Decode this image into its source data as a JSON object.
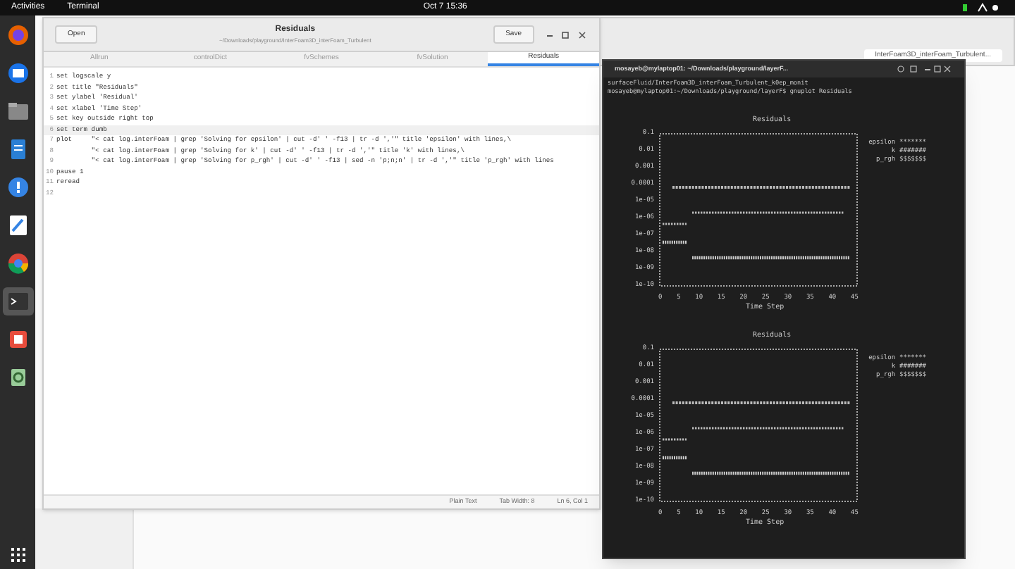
{
  "top_bar": {
    "activities": "Activities",
    "app_menu": "Terminal",
    "clock": "Oct 7  15:36"
  },
  "dock": [
    {
      "kind": "firefox",
      "selected": false
    },
    {
      "kind": "mail",
      "selected": false
    },
    {
      "kind": "files",
      "selected": false
    },
    {
      "kind": "writer",
      "selected": false
    },
    {
      "kind": "help",
      "selected": false
    },
    {
      "kind": "editor",
      "selected": false
    },
    {
      "kind": "chrome",
      "selected": false
    },
    {
      "kind": "terminal",
      "selected": true
    },
    {
      "kind": "software",
      "selected": false
    },
    {
      "kind": "recycle",
      "selected": false
    }
  ],
  "back_window": {
    "tab": "InterFoam3D_interFoam_Turbulent..."
  },
  "editor": {
    "open_button": "Open",
    "title": "Residuals",
    "subtitle": "~/Downloads/playground/InterFoam3D_interFoam_Turbulent",
    "save_button": "Save",
    "tabs": [
      {
        "label": "Allrun",
        "selected": false
      },
      {
        "label": "controlDict",
        "selected": false
      },
      {
        "label": "fvSchemes",
        "selected": false
      },
      {
        "label": "fvSolution",
        "selected": false
      },
      {
        "label": "Residuals",
        "selected": true
      }
    ],
    "lines": [
      {
        "number": "1",
        "text": "set logscale y"
      },
      {
        "number": "2",
        "text": "set title \"Residuals\""
      },
      {
        "number": "3",
        "text": "set ylabel 'Residual'"
      },
      {
        "number": "4",
        "text": "set xlabel 'Time Step'"
      },
      {
        "number": "5",
        "text": "set key outside right top"
      },
      {
        "number": "6",
        "text": "set term dumb"
      },
      {
        "number": "7",
        "text": "plot     \"< cat log.interFoam | grep 'Solving for epsilon' | cut -d' ' -f13 | tr -d ','\" title 'epsilon' with lines,\\"
      },
      {
        "number": "8",
        "text": "         \"< cat log.interFoam | grep 'Solving for k' | cut -d' ' -f13 | tr -d ','\" title 'k' with lines,\\"
      },
      {
        "number": "9",
        "text": "         \"< cat log.interFoam | grep 'Solving for p_rgh' | cut -d' ' -f13 | sed -n 'p;n;n' | tr -d ','\" title 'p_rgh' with lines"
      },
      {
        "number": "10",
        "text": "pause 1"
      },
      {
        "number": "11",
        "text": "reread"
      },
      {
        "number": "12"
      }
    ],
    "status": [
      "Plain Text",
      "Tab Width: 8",
      "Ln 6, Col 1"
    ]
  },
  "terminal": {
    "title": "mosayeb@mylaptop01: ~/Downloads/playground/layerF...",
    "output": [
      "surfaceFluid/InterFoam3D_interFoam_Turbulent_k0ep_monit",
      "mosayeb@mylaptop01:~/Downloads/playground/layerF$ gnuplot Residuals"
    ],
    "plots": [
      {
        "title": "Residuals",
        "yticks": [
          "0.1",
          "0.01",
          "0.001",
          "0.0001",
          "1e-05",
          "1e-06",
          "1e-07",
          "1e-08",
          "1e-09",
          "1e-10"
        ],
        "xticks": [
          "0",
          "5",
          "10",
          "15",
          "20",
          "25",
          "30",
          "35",
          "40",
          "45"
        ],
        "xlabel": "Time Step",
        "legend": [
          {
            "name": "epsilon",
            "mark": "*******"
          },
          {
            "name": "k",
            "mark": "#######"
          },
          {
            "name": "p_rgh",
            "mark": "$$$$$$$"
          }
        ]
      },
      {
        "title": "Residuals",
        "yticks": [
          "0.1",
          "0.01",
          "0.001",
          "0.0001",
          "1e-05",
          "1e-06",
          "1e-07",
          "1e-08",
          "1e-09",
          "1e-10"
        ],
        "xticks": [
          "0",
          "5",
          "10",
          "15",
          "20",
          "25",
          "30",
          "35",
          "40",
          "45"
        ],
        "xlabel": "Time Step",
        "legend": [
          {
            "name": "epsilon",
            "mark": "*******"
          },
          {
            "name": "k",
            "mark": "#######"
          },
          {
            "name": "p_rgh",
            "mark": "$$$$$$$"
          }
        ]
      }
    ]
  }
}
